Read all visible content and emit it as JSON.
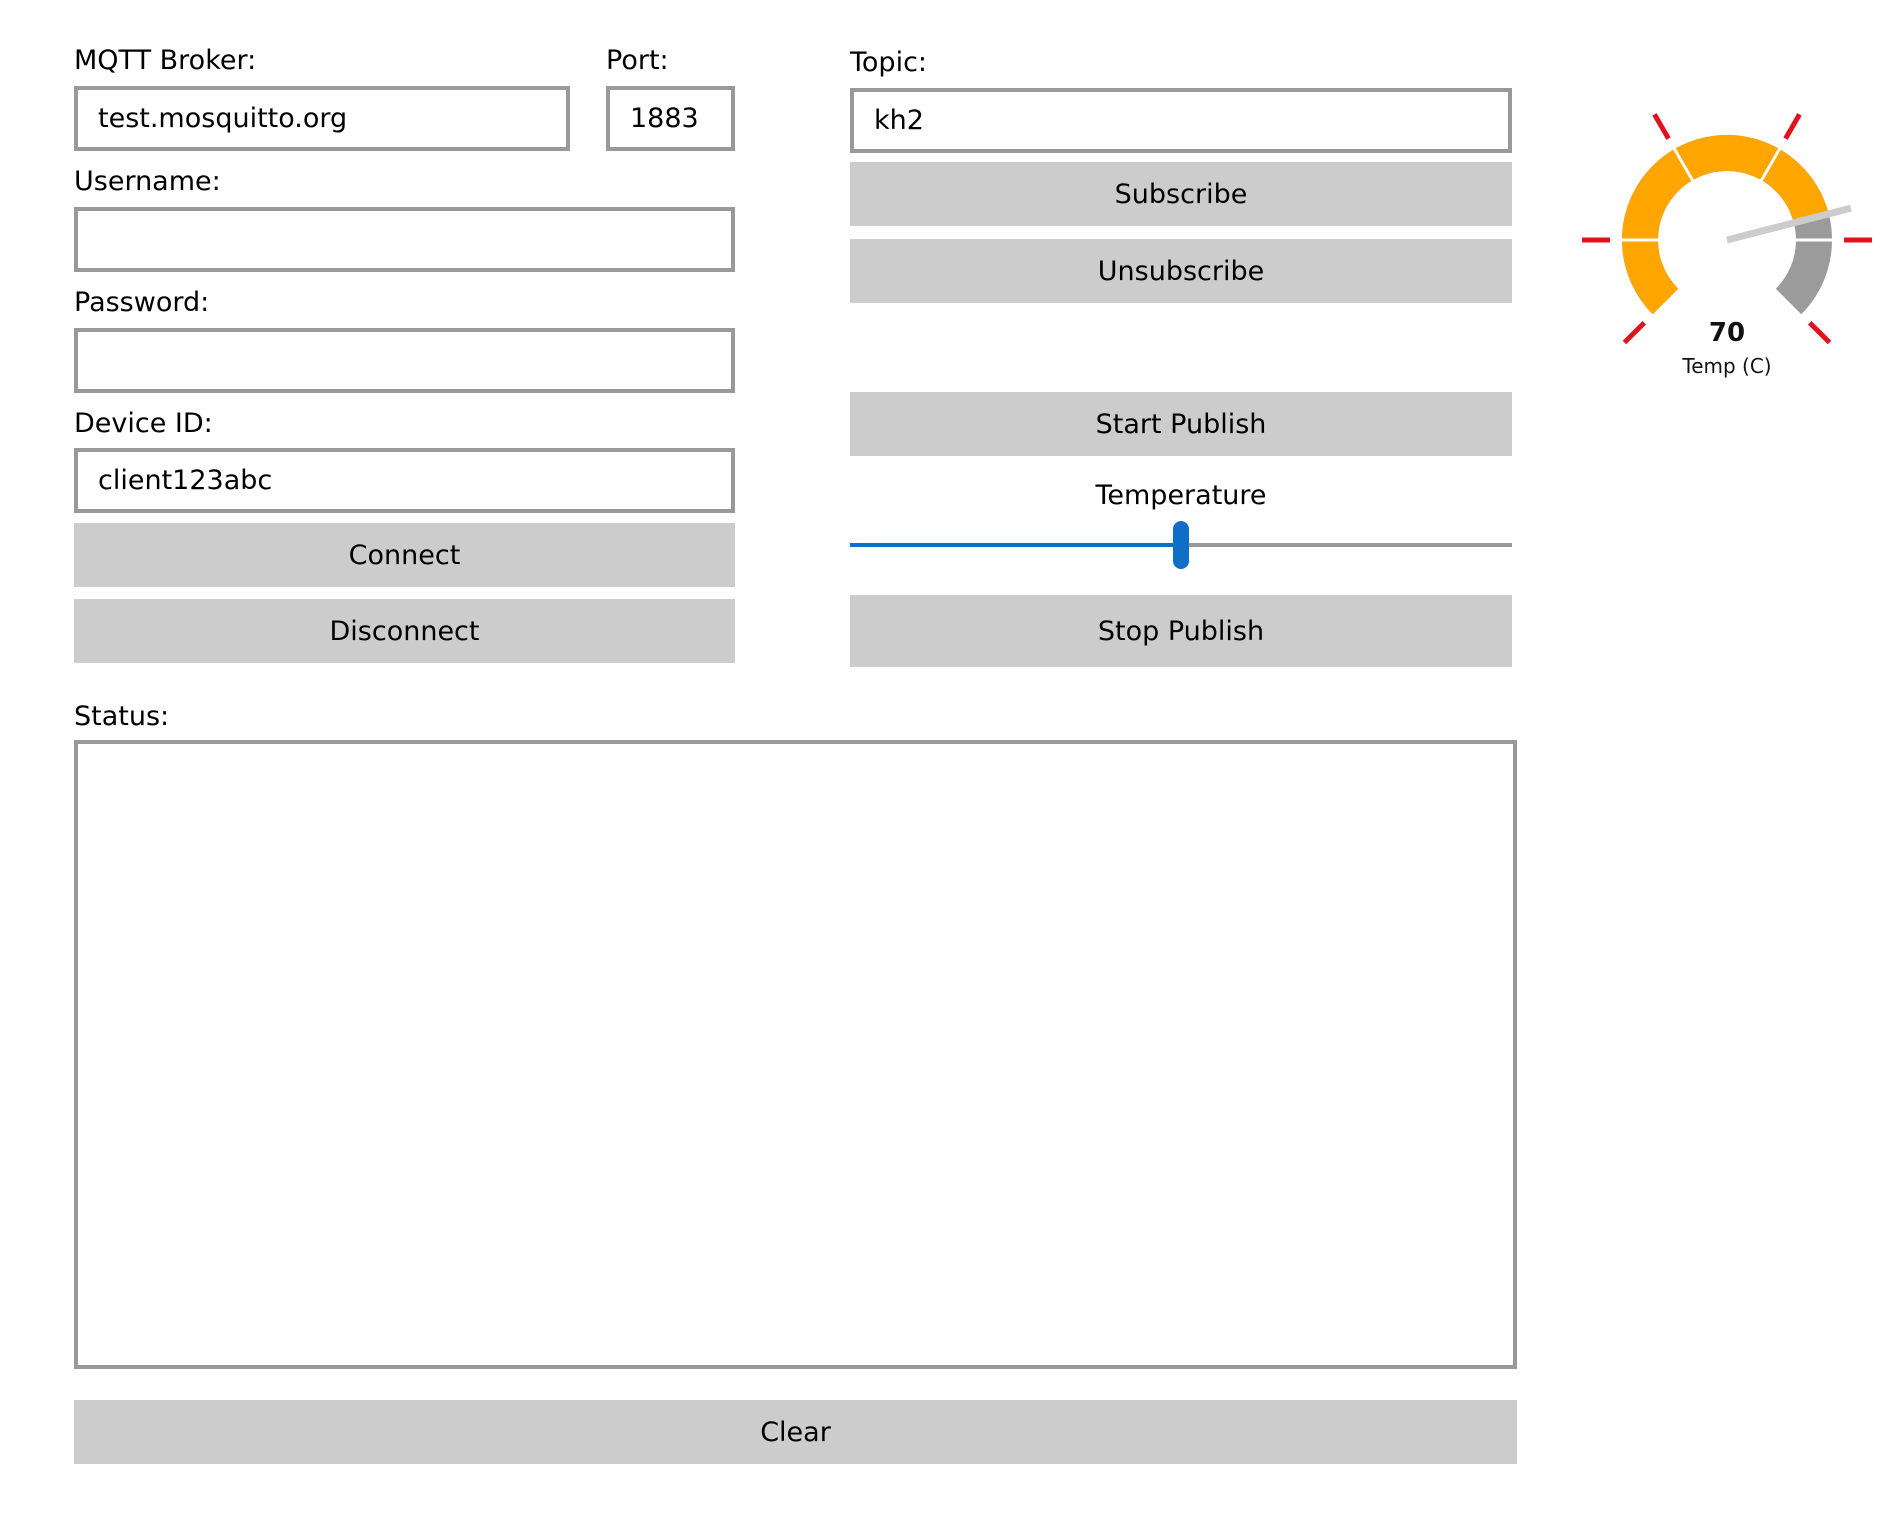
{
  "connection": {
    "broker_label": "MQTT Broker:",
    "broker_value": "test.mosquitto.org",
    "port_label": "Port:",
    "port_value": "1883",
    "username_label": "Username:",
    "username_value": "",
    "password_label": "Password:",
    "password_value": "",
    "device_id_label": "Device ID:",
    "device_id_value": "client123abc",
    "connect_label": "Connect",
    "disconnect_label": "Disconnect"
  },
  "topic": {
    "label": "Topic:",
    "value": "kh2",
    "subscribe_label": "Subscribe",
    "unsubscribe_label": "Unsubscribe"
  },
  "publish": {
    "start_label": "Start Publish",
    "stop_label": "Stop Publish",
    "slider_label": "Temperature",
    "slider_fraction": 0.5
  },
  "status": {
    "label": "Status:",
    "content": "",
    "clear_label": "Clear"
  },
  "gauge": {
    "value": 70,
    "value_text": "70",
    "caption": "Temp (C)",
    "value_fraction": 0.78
  },
  "colors": {
    "button_bg": "#cccccc",
    "border": "#999999",
    "accent": "#0f6fc6",
    "gauge_fill": "#ffa500",
    "gauge_track": "#9b9b9b",
    "gauge_tick": "#e0121b",
    "gauge_needle": "#cccccc"
  }
}
